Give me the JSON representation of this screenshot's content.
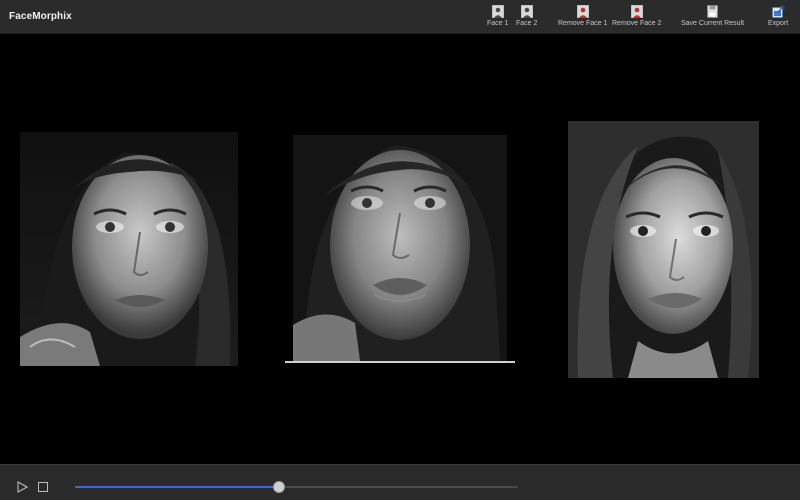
{
  "app": {
    "title": "FaceMorphix"
  },
  "toolbar": {
    "items": [
      {
        "id": "face1",
        "label": "Face 1",
        "icon": "person-icon"
      },
      {
        "id": "face2",
        "label": "Face 2",
        "icon": "person-icon"
      },
      {
        "id": "remove_face1",
        "label": "Remove Face 1",
        "icon": "person-remove-icon"
      },
      {
        "id": "remove_face2",
        "label": "Remove Face 2",
        "icon": "person-remove-icon"
      },
      {
        "id": "save",
        "label": "Save Current Result",
        "icon": "floppy-disk-icon"
      },
      {
        "id": "export",
        "label": "Export",
        "icon": "export-icon"
      }
    ]
  },
  "playback": {
    "progress": 0.46
  },
  "colors": {
    "toolbar_bg": "#2b2b2b",
    "canvas_bg": "#000000",
    "slider_fill": "#2f6fe0",
    "remove_icon": "#b83232"
  }
}
